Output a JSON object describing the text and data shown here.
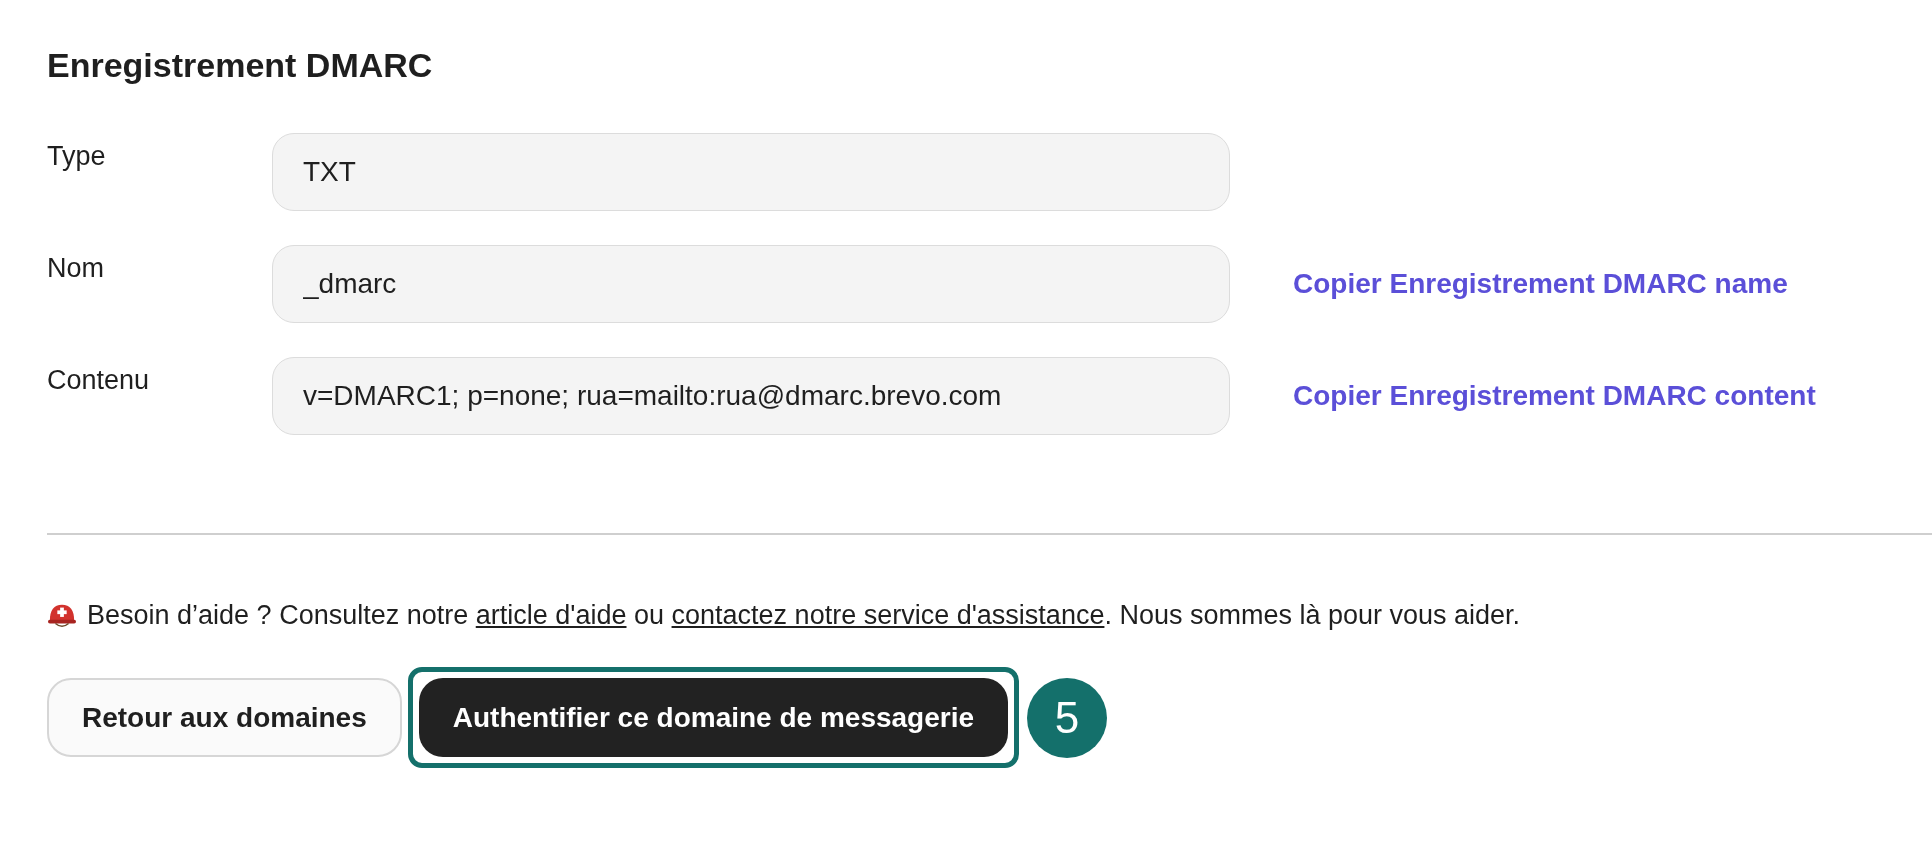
{
  "title": "Enregistrement DMARC",
  "fields": [
    {
      "label": "Type",
      "value": "TXT"
    },
    {
      "label": "Nom",
      "value": "_dmarc",
      "copy_link": "Copier Enregistrement DMARC name"
    },
    {
      "label": "Contenu",
      "value": "v=DMARC1; p=none; rua=mailto:rua@dmarc.brevo.com",
      "copy_link": "Copier Enregistrement DMARC content"
    }
  ],
  "help": {
    "before": "Besoin d’aide ? Consultez notre ",
    "link_1": "article d'aide",
    "middle": " ou ",
    "link_2": "contactez notre service d'assistance",
    "after": ". Nous sommes là pour vous aider."
  },
  "buttons": {
    "back": "Retour aux domaines",
    "primary": "Authentifier ce domaine de messagerie"
  },
  "step_badge": "5"
}
